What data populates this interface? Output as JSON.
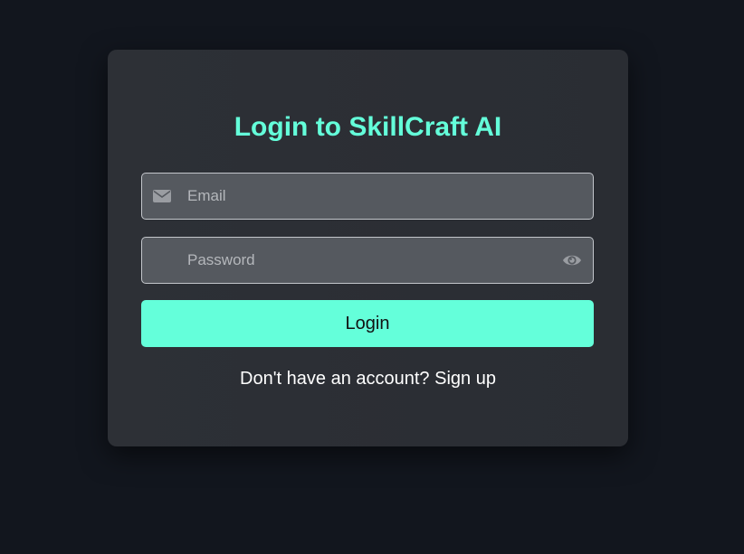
{
  "login_card": {
    "title": "Login to SkillCraft AI",
    "email": {
      "placeholder": "Email",
      "value": "",
      "icon": "envelope-icon"
    },
    "password": {
      "placeholder": "Password",
      "value": "",
      "toggle_icon": "eye-icon"
    },
    "login_button_label": "Login",
    "signup_prompt": "Don't have an account?",
    "signup_link_label": "Sign up"
  },
  "colors": {
    "page_background": "#12161e",
    "card_background": "#2d3036",
    "accent": "#64ffda",
    "input_background": "#55595f"
  }
}
